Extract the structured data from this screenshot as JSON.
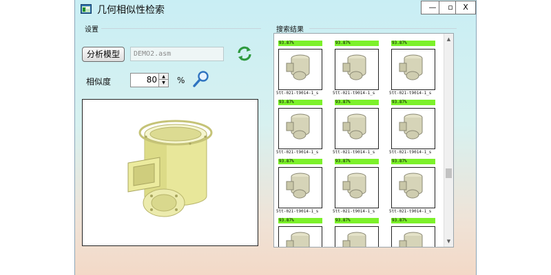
{
  "window": {
    "title": "几何相似性检索",
    "app_icon": "app-window-icon",
    "controls": {
      "minimize": "—",
      "maximize": "▫",
      "close": "X"
    }
  },
  "settings": {
    "group_label": "设置",
    "analyze_button": "分析模型",
    "file_value": "DEMO2.asm",
    "refresh_icon": "refresh-icon",
    "similarity_label": "相似度",
    "similarity_value": "80",
    "percent_symbol": "%",
    "search_icon": "magnifier-icon"
  },
  "results": {
    "group_label": "搜索结果",
    "items": [
      {
        "similarity": "93.87%",
        "name": "5tt-021-t9014-1_s"
      },
      {
        "similarity": "93.87%",
        "name": "5tt-021-t9014-1_s"
      },
      {
        "similarity": "93.87%",
        "name": "5tt-021-t9014-1_s"
      },
      {
        "similarity": "93.87%",
        "name": "5tt-021-t9014-1_s"
      },
      {
        "similarity": "93.87%",
        "name": "5tt-021-t9014-1_s"
      },
      {
        "similarity": "93.87%",
        "name": "5tt-021-t9014-1_s"
      },
      {
        "similarity": "93.87%",
        "name": "5tt-021-t9014-1_s"
      },
      {
        "similarity": "93.87%",
        "name": "5tt-021-t9014-1_s"
      },
      {
        "similarity": "93.87%",
        "name": "5tt-021-t9014-1_s"
      },
      {
        "similarity": "93.87%",
        "name": ""
      },
      {
        "similarity": "93.87%",
        "name": ""
      },
      {
        "similarity": "93.87%",
        "name": ""
      }
    ]
  },
  "colors": {
    "similarity_bar": "#7cf12a",
    "model_yellow": "#e9e88a"
  }
}
